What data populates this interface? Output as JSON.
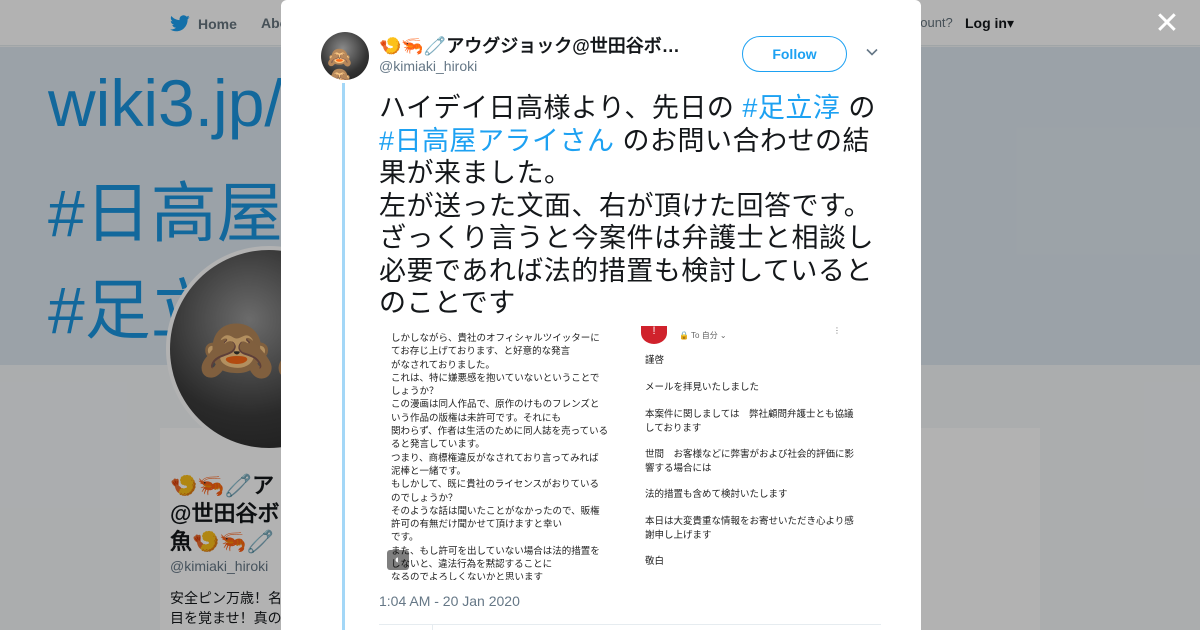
{
  "background": {
    "nav": {
      "home_label": "Home",
      "about_label": "Abo",
      "account_prompt": "account?",
      "login_label": "Log in"
    },
    "banner_lines": [
      "wiki3.jp/",
      "#日高屋",
      "#足立"
    ],
    "profile": {
      "name_lines": [
        "🍤🦐🧷ア",
        "@世田谷ボ",
        "魚🍤🦐🧷"
      ],
      "handle": "@kimiaki_hiroki",
      "bio_lines": [
        "安全ピン万歳！名",
        "目を覚ませ！真の"
      ]
    }
  },
  "modal": {
    "close_icon": "close-icon",
    "author": {
      "display_name": "🍤🦐🧷アウグジョック@世田谷ボ…",
      "handle": "@kimiaki_hiroki",
      "avatar_emoji": "🙈🙈"
    },
    "follow_label": "Follow",
    "tweet": {
      "p1_before": "ハイデイ日高様より、先日の ",
      "hashtag1": "#足立淳",
      "p1_mid": " の ",
      "hashtag2": "#日高屋アライさん",
      "p1_after": " のお問い合わせの結果が来ました。",
      "p2": "左が送った文面、右が頂けた回答です。",
      "p3": "ざっくり言うと今案件は弁護士と相談し必要であれば法的措置も検討しているとのことです"
    },
    "media": {
      "left_lines": [
        "しかしながら、貴社のオフィシャルツイッターに",
        "てお存じ上げております、と好意的な発言",
        "がなされておりました。",
        "これは、特に嫌悪感を抱いていないということで",
        "しょうか？",
        "この漫画は同人作品で、原作のけものフレンズと",
        "いう作品の版権は未許可です。それにも",
        "関わらず、作者は生活のために同人誌を売っている",
        "ると発言しています。",
        "つまり、商標権違反がなされており言ってみれば",
        "泥棒と一緒です。",
        "もしかして、既に貴社のライセンスがおりている",
        "のでしょうか？",
        "そのような話は聞いたことがなかったので、販権",
        "許可の有無だけ聞かせて頂けますと幸い",
        "です。",
        "また、もし許可を出していない場合は法的措置を",
        "しないと、違法行為を黙認することに",
        "なるのでよろしくないかと思います"
      ],
      "right": {
        "to_self": "🔒 To 自分 ⌄",
        "lines": [
          "謹啓",
          "メールを拝見いたしました",
          "本案件に関しましては　弊社顧問弁護士とも協議",
          "しております",
          "世間　お客様などに弊害がおよび社会的評価に影",
          "響する場合には",
          "法的措置も含めて検討いたします",
          "本日は大変貴重な情報をお寄せいただき心より感",
          "謝申し上げます",
          "敬白"
        ]
      }
    },
    "timestamp": "1:04 AM - 20 Jan 2020"
  }
}
